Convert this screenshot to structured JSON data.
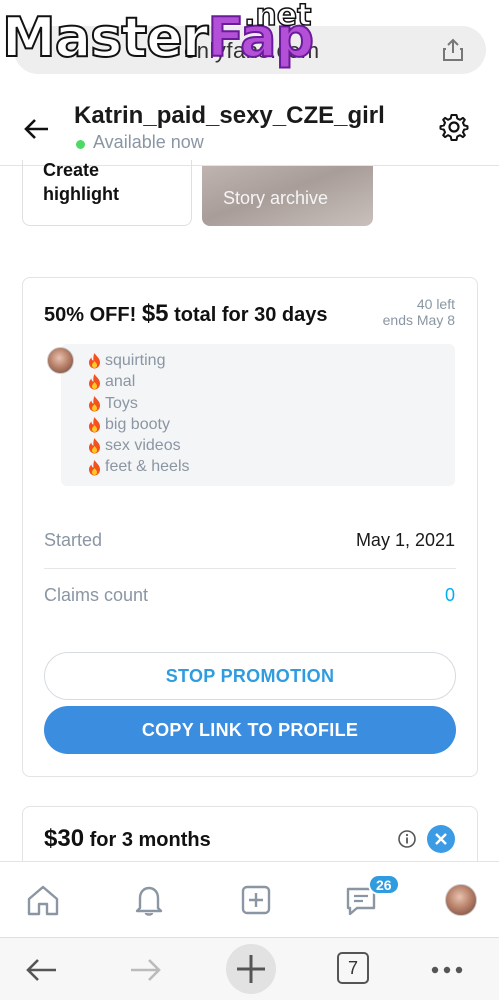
{
  "browser": {
    "url_text": "onlyfans.com",
    "watermark": "MasterFap",
    "watermark_part1": "Master",
    "watermark_part2": "Fap",
    "watermark_tld": ".net",
    "tab_count": "7"
  },
  "header": {
    "profile_name": "Katrin_paid_sexy_CZE_girl",
    "status": "Available now"
  },
  "highlights": {
    "create_label": "Create highlight",
    "archive_label": "Story archive"
  },
  "promo": {
    "title_prefix": "50% OFF!",
    "price": "$5",
    "title_suffix": "total for 30 days",
    "remaining": "40 left",
    "ends": "ends May 8",
    "tags": [
      "squirting",
      "anal",
      "Toys",
      "big booty",
      "sex videos",
      "feet & heels"
    ],
    "started_label": "Started",
    "started_value": "May 1, 2021",
    "claims_label": "Claims count",
    "claims_value": "0",
    "stop_label": "STOP PROMOTION",
    "copy_label": "COPY LINK TO PROFILE"
  },
  "promo2": {
    "price": "$30",
    "title_suffix": "for 3 months"
  },
  "nav": {
    "messages_badge": "26"
  },
  "colors": {
    "accent": "#00aff0",
    "button_blue": "#3b8de0",
    "online": "#4cd964",
    "muted": "#8a96a3"
  }
}
